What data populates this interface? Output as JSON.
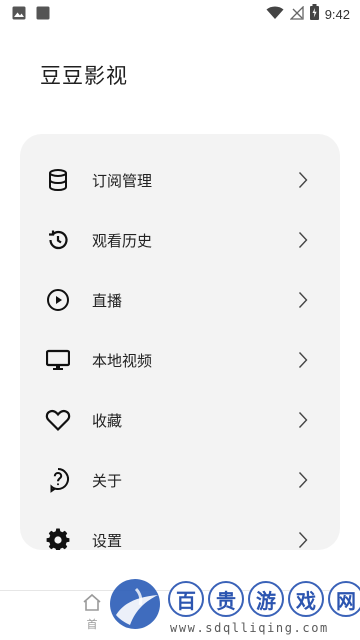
{
  "status_bar": {
    "time": "9:42"
  },
  "app": {
    "title": "豆豆影视"
  },
  "menu": {
    "items": [
      {
        "label": "订阅管理",
        "icon": "database-icon"
      },
      {
        "label": "观看历史",
        "icon": "history-icon"
      },
      {
        "label": "直播",
        "icon": "play-circle-icon"
      },
      {
        "label": "本地视频",
        "icon": "monitor-icon"
      },
      {
        "label": "收藏",
        "icon": "heart-icon"
      },
      {
        "label": "关于",
        "icon": "help-circle-icon"
      },
      {
        "label": "设置",
        "icon": "gear-icon"
      }
    ]
  },
  "bottom_nav": {
    "home_label": "首"
  },
  "watermark": {
    "chars": [
      "百",
      "贵",
      "游",
      "戏",
      "网"
    ],
    "url": "www.sdqlliqing.com"
  },
  "colors": {
    "card_bg": "#f3f3f3",
    "watermark_blue": "#2c55b0"
  }
}
